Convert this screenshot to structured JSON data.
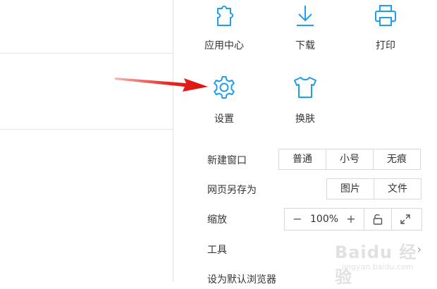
{
  "menu": {
    "tiles_row1": [
      {
        "label": "应用中心",
        "icon": "puzzle-icon"
      },
      {
        "label": "下载",
        "icon": "download-icon"
      },
      {
        "label": "打印",
        "icon": "printer-icon"
      }
    ],
    "tiles_row2": [
      {
        "label": "设置",
        "icon": "gear-icon"
      },
      {
        "label": "换肤",
        "icon": "tshirt-icon"
      }
    ],
    "new_window": {
      "label": "新建窗口",
      "options": [
        "普通",
        "小号",
        "无痕"
      ]
    },
    "save_as": {
      "label": "网页另存为",
      "options": [
        "图片",
        "文件"
      ]
    },
    "zoom": {
      "label": "缩放",
      "minus": "−",
      "value": "100%",
      "plus": "+"
    },
    "tools": {
      "label": "工具"
    },
    "default_browser": {
      "label": "设为默认浏览器"
    }
  },
  "watermark": {
    "text": "Baidu 经验",
    "sub": "jingyan.baidu.com"
  },
  "colors": {
    "icon": "#1e9fe6",
    "arrow": "#e8231f",
    "border": "#d8d8d8"
  }
}
